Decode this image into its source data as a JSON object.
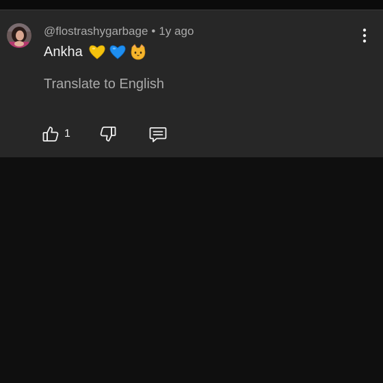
{
  "comment": {
    "author": "@flostrashygarbage",
    "separator": "•",
    "time_ago": "1y ago",
    "text": "Ankha",
    "emojis": [
      "yellow-heart",
      "blue-heart",
      "cat-face"
    ],
    "translate_label": "Translate to English",
    "like_count": "1"
  },
  "colors": {
    "page_background": "#0f0f0f",
    "card_background": "#272727",
    "primary_text": "#f1f1f1",
    "secondary_text": "#aaaaaa"
  },
  "icons": [
    "avatar",
    "more-vert-icon",
    "thumbs-up-icon",
    "thumbs-down-icon",
    "reply-comment-icon"
  ]
}
